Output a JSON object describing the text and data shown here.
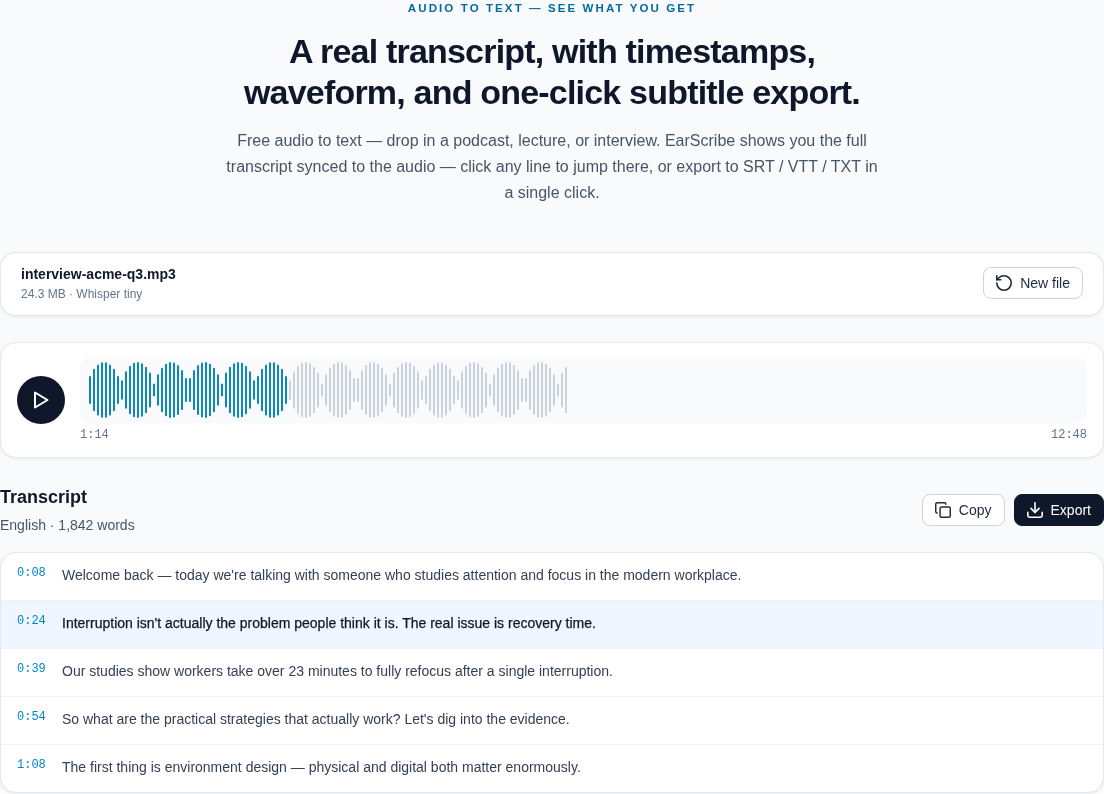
{
  "header": {
    "eyebrow": "AUDIO TO TEXT — SEE WHAT YOU GET",
    "title": "A real transcript, with timestamps, waveform, and one-click subtitle export.",
    "description": "Free audio to text — drop in a podcast, lecture, or interview. EarScribe shows you the full transcript synced to the audio — click any line to jump there, or export to SRT / VTT / TXT in a single click."
  },
  "file": {
    "name": "interview-acme-q3.mp3",
    "meta": "24.3 MB · Whisper tiny",
    "new_button": "New file"
  },
  "player": {
    "playing": false,
    "waveform": {
      "level": 0.42
    },
    "current_time": "1:14",
    "duration": "12:48"
  },
  "transcript": {
    "title": "Transcript",
    "meta": "English · 1,842 words",
    "buttons": [
      {
        "kind": "copy",
        "label": "Copy"
      },
      {
        "kind": "export",
        "label": "Export"
      }
    ],
    "lines": [
      {
        "time": "0:08",
        "text": "Welcome back — today we're talking with someone who studies attention and focus in the modern workplace.",
        "selected": false
      },
      {
        "time": "0:24",
        "text": "Interruption isn't actually the problem people think it is. The real issue is recovery time.",
        "selected": true
      },
      {
        "time": "0:39",
        "text": "Our studies show workers take over 23 minutes to fully refocus after a single interruption.",
        "selected": false
      },
      {
        "time": "0:54",
        "text": "So what are the practical strategies that actually work? Let's dig into the evidence.",
        "selected": false
      },
      {
        "time": "1:08",
        "text": "The first thing is environment design — physical and digital both matter enormously.",
        "selected": false
      }
    ]
  }
}
